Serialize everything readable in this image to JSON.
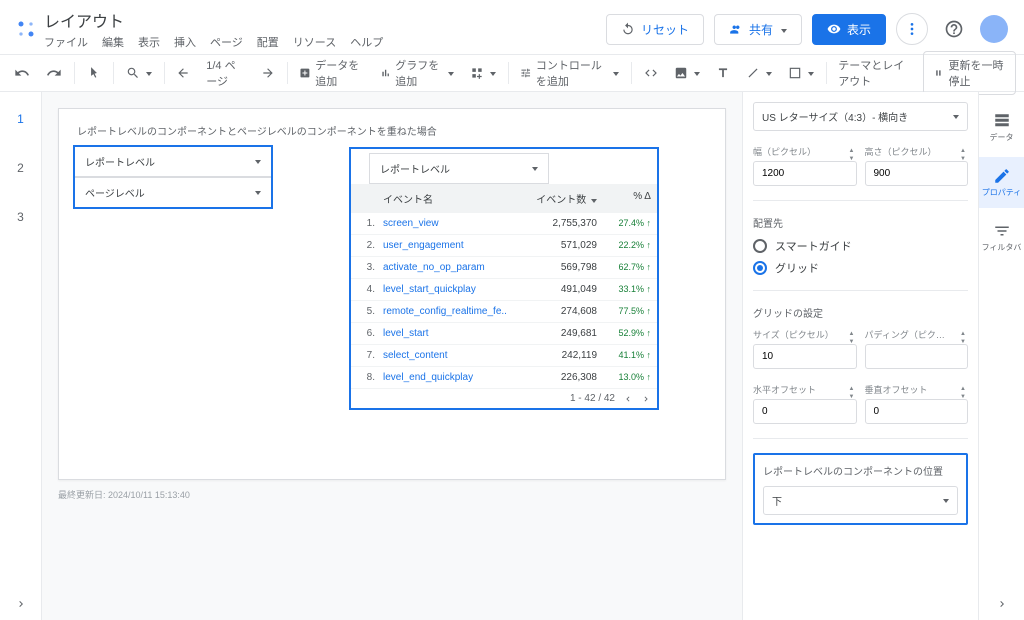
{
  "header": {
    "title": "レイアウト",
    "menu": [
      "ファイル",
      "編集",
      "表示",
      "挿入",
      "ページ",
      "配置",
      "リソース",
      "ヘルプ"
    ],
    "reset": "リセット",
    "share": "共有",
    "display": "表示"
  },
  "toolbar": {
    "page_info": "1/4 ページ",
    "add_data": "データを追加",
    "add_chart": "グラフを追加",
    "add_control": "コントロールを追加",
    "theme": "テーマとレイアウト",
    "pause": "更新を一時停止"
  },
  "pages": [
    "1",
    "2",
    "3"
  ],
  "canvas": {
    "title": "レポートレベルのコンポーネントとページレベルのコンポーネントを重ねた場合",
    "dropdown1": "レポートレベル",
    "dropdown2": "ページレベル",
    "chart_dropdown": "レポートレベル",
    "table_headers": {
      "name": "イベント名",
      "count": "イベント数",
      "delta": "% Δ"
    },
    "pagination": "1 - 42 / 42",
    "timestamp": "最終更新日: 2024/10/11 15:13:40"
  },
  "chart_data": {
    "type": "table",
    "rows": [
      {
        "n": "1.",
        "name": "screen_view",
        "count": "2,755,370",
        "delta": "27.4% ↑"
      },
      {
        "n": "2.",
        "name": "user_engagement",
        "count": "571,029",
        "delta": "22.2% ↑"
      },
      {
        "n": "3.",
        "name": "activate_no_op_param",
        "count": "569,798",
        "delta": "62.7% ↑"
      },
      {
        "n": "4.",
        "name": "level_start_quickplay",
        "count": "491,049",
        "delta": "33.1% ↑"
      },
      {
        "n": "5.",
        "name": "remote_config_realtime_fe..",
        "count": "274,608",
        "delta": "77.5% ↑"
      },
      {
        "n": "6.",
        "name": "level_start",
        "count": "249,681",
        "delta": "52.9% ↑"
      },
      {
        "n": "7.",
        "name": "select_content",
        "count": "242,119",
        "delta": "41.1% ↑"
      },
      {
        "n": "8.",
        "name": "level_end_quickplay",
        "count": "226,308",
        "delta": "13.0% ↑"
      }
    ]
  },
  "right": {
    "canvas_size": "US レターサイズ（4:3）- 横向き",
    "width_label": "幅（ピクセル）",
    "height_label": "高さ（ピクセル）",
    "width": "1200",
    "height": "900",
    "snap_title": "配置先",
    "snap_opt1": "スマートガイド",
    "snap_opt2": "グリッド",
    "grid_title": "グリッドの設定",
    "size_label": "サイズ（ピクセル）",
    "padding_label": "パディング（ピク…",
    "size": "10",
    "padding": "",
    "h_offset_label": "水平オフセット",
    "v_offset_label": "垂直オフセット",
    "h_offset": "0",
    "v_offset": "0",
    "component_pos_title": "レポートレベルのコンポーネントの位置",
    "component_pos_value": "下"
  },
  "tabs": {
    "data": "データ",
    "property": "プロパティ",
    "filter": "フィルタバ"
  }
}
